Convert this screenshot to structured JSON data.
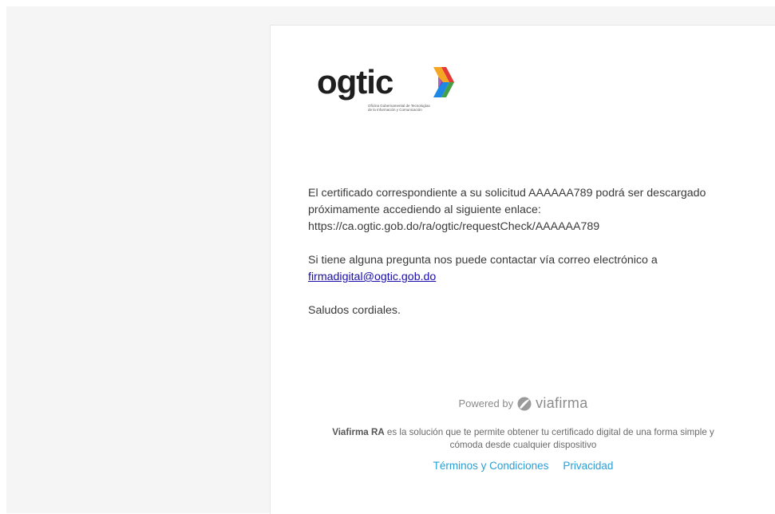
{
  "brand": {
    "logo_word": "ogtic",
    "logo_sub_line1": "Oficina Gubernamental de Tecnologías",
    "logo_sub_line2": "de la Información y Comunicación",
    "arrow_colors": [
      "#f5a623",
      "#e53935",
      "#1e88e5",
      "#43a047",
      "#8e24aa"
    ]
  },
  "message": {
    "line1": "El certificado correspondiente a su solicitud AAAAAA789 podrá ser descargado",
    "line2": "próximamente accediendo al siguiente enlace:",
    "url": "https://ca.ogtic.gob.do/ra/ogtic/requestCheck/AAAAAA789",
    "contact_text": "Si tiene alguna pregunta nos puede contactar vía correo electrónico a",
    "email": "firmadigital@ogtic.gob.do",
    "closing": "Saludos cordiales."
  },
  "footer": {
    "powered_by": "Powered by",
    "viafirma": "viafirma",
    "desc_bold": "Viafirma RA",
    "desc_rest": " es la solución que te permite obtener tu certificado digital de una forma simple y cómoda desde cualquier dispositivo",
    "terms": "Términos y Condiciones",
    "privacy": "Privacidad"
  }
}
